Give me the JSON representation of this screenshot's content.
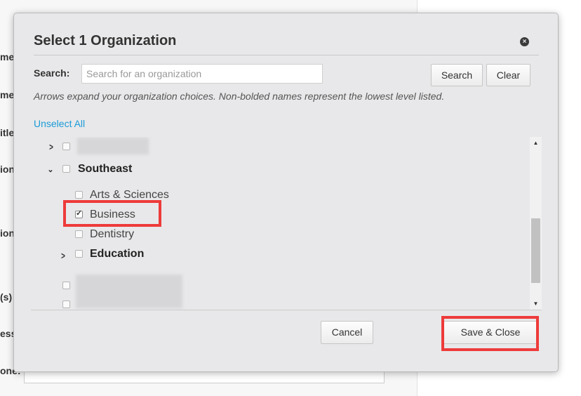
{
  "background": {
    "side_labels": [
      "me",
      "me",
      "itle",
      "ion",
      "ion",
      "(s)",
      "ess",
      "one:"
    ]
  },
  "modal": {
    "title": "Select 1 Organization",
    "close_glyph": "×",
    "search": {
      "label": "Search:",
      "placeholder": "Search for an organization",
      "value": ""
    },
    "buttons": {
      "search": "Search",
      "clear": "Clear",
      "cancel": "Cancel",
      "save": "Save & Close"
    },
    "hint": "Arrows expand your organization choices. Non-bolded names represent the lowest level listed.",
    "unselect_all": "Unselect All",
    "tree": {
      "parent": {
        "label": "Southeast",
        "expanded": true,
        "checked": false
      },
      "children": [
        {
          "label": "Arts & Sciences",
          "checked": false,
          "bold": false,
          "expandable": false
        },
        {
          "label": "Business",
          "checked": true,
          "bold": false,
          "expandable": false
        },
        {
          "label": "Dentistry",
          "checked": false,
          "bold": false,
          "expandable": false
        },
        {
          "label": "Education",
          "checked": false,
          "bold": true,
          "expandable": true
        }
      ]
    },
    "highlight_color": "#ee3b3b",
    "link_color": "#1a9bd7",
    "icons": {
      "expand": "chevron-right-icon",
      "collapse": "chevron-down-icon",
      "close": "close-circle-icon",
      "scroll_up": "arrow-up-icon",
      "scroll_down": "arrow-down-icon"
    }
  }
}
